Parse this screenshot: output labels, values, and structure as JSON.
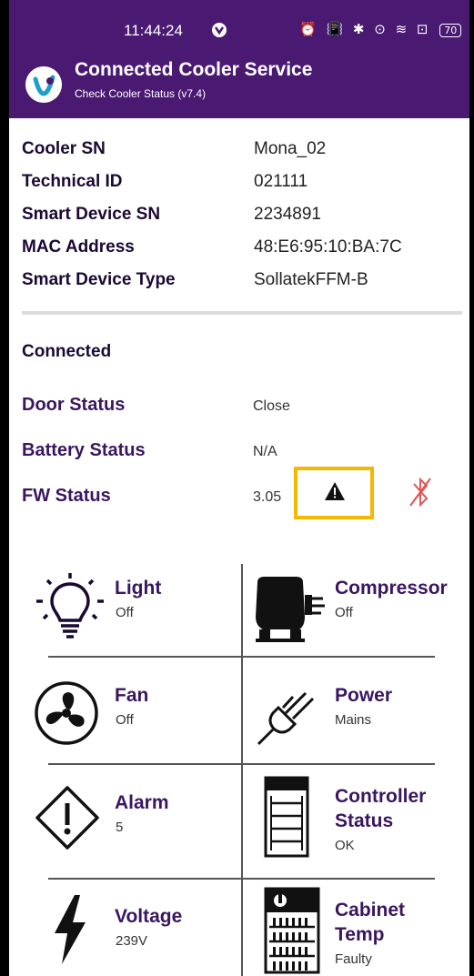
{
  "status_bar": {
    "time": "11:44:24",
    "icons": "⏰ 📳 ✱ ⊙ ≋ ⊡",
    "battery": "70"
  },
  "app_bar": {
    "title": "Connected Cooler Service",
    "subtitle": "Check Cooler Status (v7.4)"
  },
  "device_info": [
    {
      "label": "Cooler SN",
      "value": "Mona_02"
    },
    {
      "label": "Technical ID",
      "value": "021111"
    },
    {
      "label": "Smart Device SN",
      "value": "2234891"
    },
    {
      "label": "MAC Address",
      "value": "48:E6:95:10:BA:7C"
    },
    {
      "label": "Smart Device Type",
      "value": "SollatekFFM-B"
    }
  ],
  "connection_status": "Connected",
  "statuses": [
    {
      "label": "Door Status",
      "value": "Close"
    },
    {
      "label": "Battery Status",
      "value": "N/A"
    },
    {
      "label": "FW Status",
      "value": "3.05"
    }
  ],
  "tiles": [
    {
      "title": "Light",
      "value": "Off",
      "icon": "lightbulb-icon"
    },
    {
      "title": "Compressor",
      "value": "Off",
      "icon": "compressor-icon"
    },
    {
      "title": "Fan",
      "value": "Off",
      "icon": "fan-icon"
    },
    {
      "title": "Power",
      "value": "Mains",
      "icon": "plug-icon"
    },
    {
      "title": "Alarm",
      "value": "5",
      "icon": "alarm-icon"
    },
    {
      "title_line1": "Controller",
      "title_line2": "Status",
      "value": "OK",
      "icon": "cooler-icon"
    },
    {
      "title": "Voltage",
      "value": "239V",
      "icon": "lightning-icon"
    },
    {
      "title_line1": "Cabinet",
      "title_line2": "Temp",
      "value": "Faulty",
      "icon": "cabinet-temp-icon"
    }
  ],
  "colors": {
    "header": "#4a1a73",
    "label": "#3a1660",
    "warning_highlight": "#f5b800",
    "bluetooth_off": "#e05555"
  }
}
